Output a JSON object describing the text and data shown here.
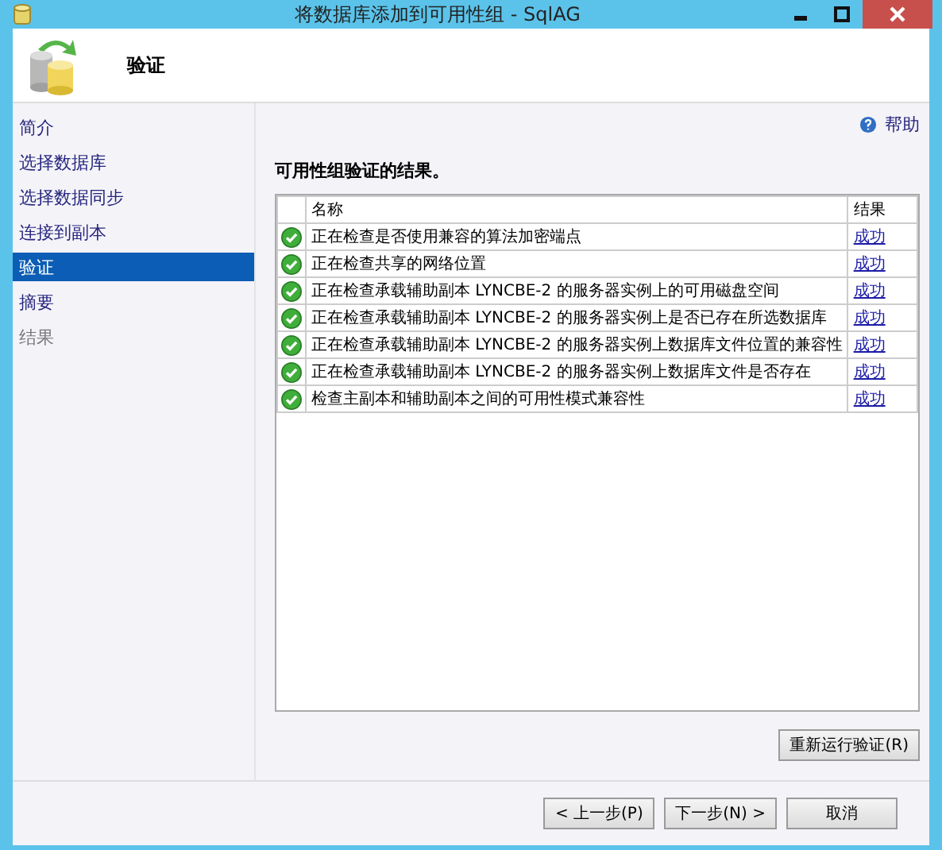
{
  "window": {
    "title": "将数据库添加到可用性组 - SqlAG"
  },
  "header": {
    "title": "验证"
  },
  "sidebar": {
    "items": [
      {
        "label": "简介",
        "selected": false,
        "disabled": false
      },
      {
        "label": "选择数据库",
        "selected": false,
        "disabled": false
      },
      {
        "label": "选择数据同步",
        "selected": false,
        "disabled": false
      },
      {
        "label": "连接到副本",
        "selected": false,
        "disabled": false
      },
      {
        "label": "验证",
        "selected": true,
        "disabled": false
      },
      {
        "label": "摘要",
        "selected": false,
        "disabled": false
      },
      {
        "label": "结果",
        "selected": false,
        "disabled": true
      }
    ]
  },
  "help": {
    "label": "帮助"
  },
  "section_title": "可用性组验证的结果。",
  "table": {
    "columns": [
      "名称",
      "结果"
    ],
    "rows": [
      {
        "name": "正在检查是否使用兼容的算法加密端点",
        "result": "成功"
      },
      {
        "name": "正在检查共享的网络位置",
        "result": "成功"
      },
      {
        "name": "正在检查承载辅助副本 LYNCBE-2 的服务器实例上的可用磁盘空间",
        "result": "成功"
      },
      {
        "name": "正在检查承载辅助副本 LYNCBE-2 的服务器实例上是否已存在所选数据库",
        "result": "成功"
      },
      {
        "name": "正在检查承载辅助副本 LYNCBE-2 的服务器实例上数据库文件位置的兼容性",
        "result": "成功"
      },
      {
        "name": "正在检查承载辅助副本 LYNCBE-2 的服务器实例上数据库文件是否存在",
        "result": "成功"
      },
      {
        "name": "检查主副本和辅助副本之间的可用性模式兼容性",
        "result": "成功"
      }
    ]
  },
  "rerun_button": "重新运行验证(R)",
  "buttons": [
    "< 上一步(P)",
    "下一步(N) >",
    "取消"
  ]
}
